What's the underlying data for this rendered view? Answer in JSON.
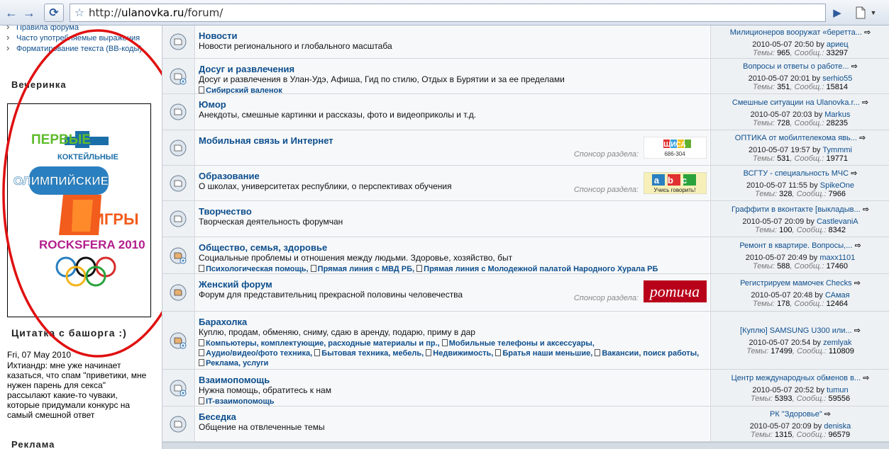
{
  "browser": {
    "url_prefix": "http://",
    "url_host": "ulanovka.ru",
    "url_path": "/forum/"
  },
  "sidebar": {
    "rules": [
      "Правила форума",
      "Часто употребляемые выражения",
      "Форматирование текста (BB-коды)"
    ],
    "party_heading": "Вечеринка",
    "banner_lines": [
      "ПЕРВЫЕ",
      "КОКТЕЙЛЬНЫЕ",
      "ОЛИМПИЙСКИЕ",
      "ИГРЫ",
      "ROCKSFERA 2010"
    ],
    "quote_heading": "Цитатка с башорга :)",
    "quote_date": "Fri, 07 May 2010",
    "quote_text": "Ихтиандр: мне уже начинает казаться, что спам \"приветики, мне нужен парень для секса\" рассылают какие-то чуваки, которые придумали конкурс на самый смешной ответ",
    "ads_heading": "Реклама"
  },
  "forums": [
    {
      "title": "Новости",
      "desc": "Новости регионального и глобального масштаба",
      "subs": [],
      "last_topic": "Милиционеров вооружат «беретта...",
      "last_date": "2010-05-07 20:50",
      "last_user": "ариец",
      "topics": "965",
      "posts": "33297"
    },
    {
      "title": "Досуг и развлечения",
      "desc": "Досуг и развлечения в Улан-Удэ, Афиша, Гид по стилю, Отдых в Бурятии и за ее пределами",
      "subs": [
        "Сибирский валенок"
      ],
      "last_topic": "Вопросы и ответы о работе...",
      "last_date": "2010-05-07 20:01",
      "last_user": "serhio55",
      "topics": "351",
      "posts": "15814"
    },
    {
      "title": "Юмор",
      "desc": "Анекдоты, смешные картинки и рассказы, фото и видеоприколы и т.д.",
      "subs": [],
      "last_topic": "Смешные ситуации на Ulanovka.r...",
      "last_date": "2010-05-07 20:03",
      "last_user": "Markus",
      "topics": "728",
      "posts": "28235"
    },
    {
      "title": "Мобильная связь и Интернет",
      "desc": "",
      "subs": [],
      "sponsor": "Спонсор раздела:",
      "sponsor_logo": "ШИСА",
      "sponsor_sub": "686-304",
      "last_topic": "ОПТИКА от мобилтелекома явь...",
      "last_date": "2010-05-07 19:57",
      "last_user": "Tymmmi",
      "topics": "531",
      "posts": "19771"
    },
    {
      "title": "Образование",
      "desc": "О школах, университетах республики, о перспективах обучения",
      "subs": [],
      "sponsor": "Спонсор раздела:",
      "sponsor_logo": "abc",
      "sponsor_sub": "Учись говорить!",
      "last_topic": "ВСГТУ - специальность МЧС",
      "last_date": "2010-05-07 11:55",
      "last_user": "SpikeOne",
      "topics": "328",
      "posts": "7966"
    },
    {
      "title": "Творчество",
      "desc": "Творческая деятельность форумчан",
      "subs": [],
      "last_topic": "Граффити в вконтакте [выкладыв...",
      "last_date": "2010-05-07 20:09",
      "last_user": "CastlevaniA",
      "topics": "100",
      "posts": "8342"
    },
    {
      "title": "Общество, семья, здоровье",
      "desc": "Социальные проблемы и отношения между людьми. Здоровье, хозяйство, быт",
      "subs": [
        "Психологическая помощь",
        "Прямая линия с МВД РБ",
        "Прямая линия с Молодежной палатой Народного Хурала РБ"
      ],
      "last_topic": "Ремонт в квартире. Вопросы,...",
      "last_date": "2010-05-07 20:49",
      "last_user": "maxx1101",
      "topics": "588",
      "posts": "17460"
    },
    {
      "title": "Женский форум",
      "desc": "Форум для представительниц прекрасной половины человечества",
      "subs": [],
      "sponsor": "Спонсор раздела:",
      "sponsor_logo": "ротича",
      "sponsor_sub": "",
      "last_topic": "Регистрируем мамочек Checks",
      "last_date": "2010-05-07 20:48",
      "last_user": "САмая",
      "topics": "178",
      "posts": "12464"
    },
    {
      "title": "Барахолка",
      "desc": "Куплю, продам, обменяю, сниму, сдаю в аренду, подарю, приму в дар",
      "subs": [
        "Компьютеры, комплектующие, расходные материалы и пр.",
        "Мобильные телефоны и аксессуары",
        "Аудио/видео/фото техника",
        "Бытовая техника, мебель",
        "Недвижимость",
        "Братья наши меньшие",
        "Вакансии, поиск работы",
        "Реклама, услуги"
      ],
      "last_topic": "[Куплю] SAMSUNG U300 или...",
      "last_date": "2010-05-07 20:54",
      "last_user": "zemlyak",
      "topics": "17499",
      "posts": "110809"
    },
    {
      "title": "Взаимопомощь",
      "desc": "Нужна помощь, обратитесь к нам",
      "subs": [
        "IT-взаимопомощь"
      ],
      "last_topic": "Центр международных обменов в...",
      "last_date": "2010-05-07 20:52",
      "last_user": "tumun",
      "topics": "5393",
      "posts": "59556"
    },
    {
      "title": "Беседка",
      "desc": "Общение на отвлеченные темы",
      "subs": [],
      "last_topic": "РК \"Здоровье\"",
      "last_date": "2010-05-07 20:09",
      "last_user": "deniska",
      "topics": "1315",
      "posts": "96579"
    }
  ],
  "labels": {
    "by": "by",
    "topics_label": "Темы:",
    "posts_label": "Сообщ.:"
  }
}
